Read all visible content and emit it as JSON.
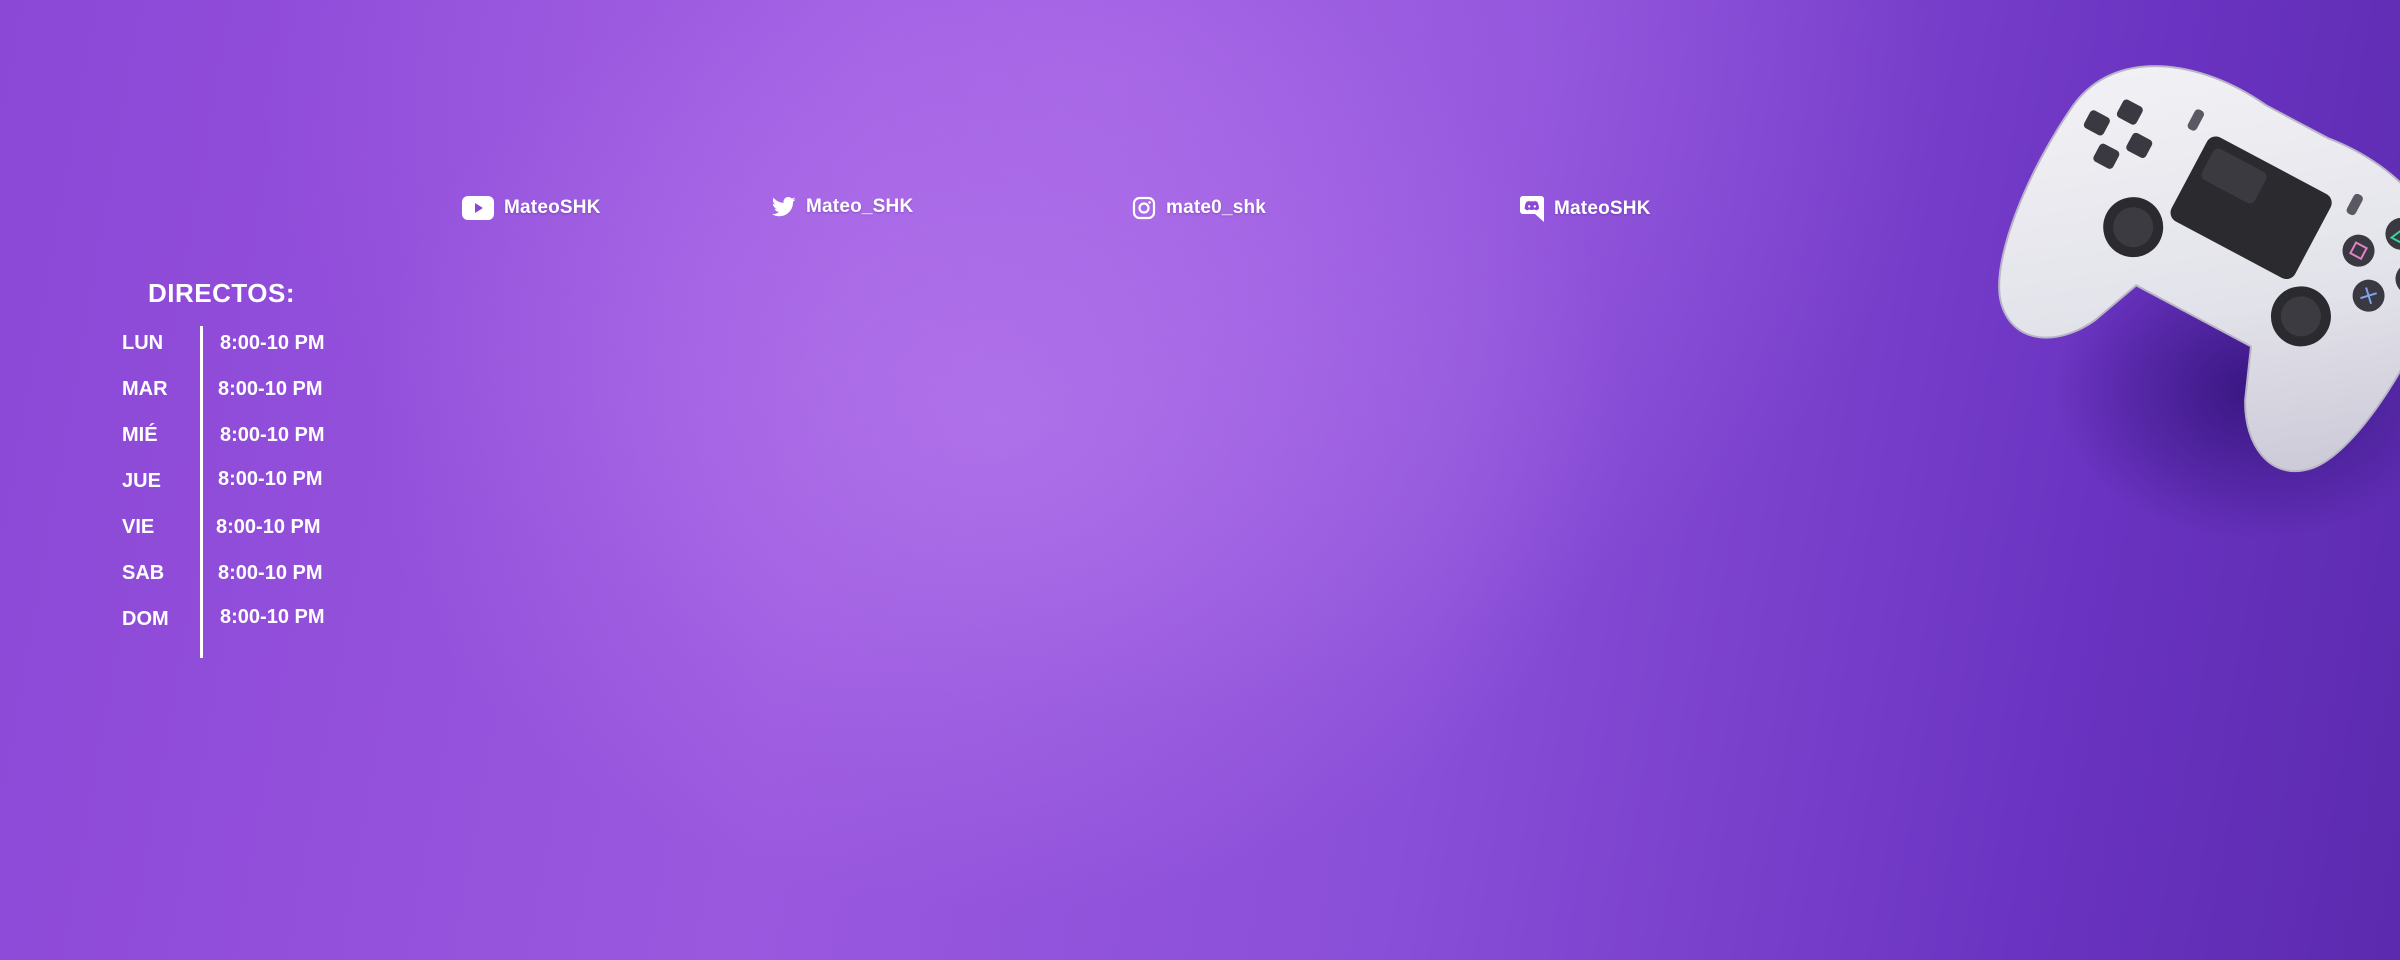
{
  "socials": [
    {
      "icon": "youtube-icon",
      "handle": "MateoSHK"
    },
    {
      "icon": "twitter-icon",
      "handle": "Mateo_SHK"
    },
    {
      "icon": "instagram-icon",
      "handle": "mate0_shk"
    },
    {
      "icon": "discord-icon",
      "handle": "MateoSHK"
    }
  ],
  "schedule": {
    "title": "DIRECTOS:",
    "rows": [
      {
        "day": "LUN",
        "time": "8:00-10 PM"
      },
      {
        "day": "MAR",
        "time": "8:00-10 PM"
      },
      {
        "day": "MIÉ",
        "time": "8:00-10 PM"
      },
      {
        "day": "JUE",
        "time": "8:00-10 PM"
      },
      {
        "day": "VIE",
        "time": "8:00-10 PM"
      },
      {
        "day": "SAB",
        "time": "8:00-10 PM"
      },
      {
        "day": "DOM",
        "time": "8:00-10 PM"
      }
    ]
  },
  "colors": {
    "background": "#8b47d6",
    "controller": "#e9e9ee",
    "text": "#ffffff"
  }
}
